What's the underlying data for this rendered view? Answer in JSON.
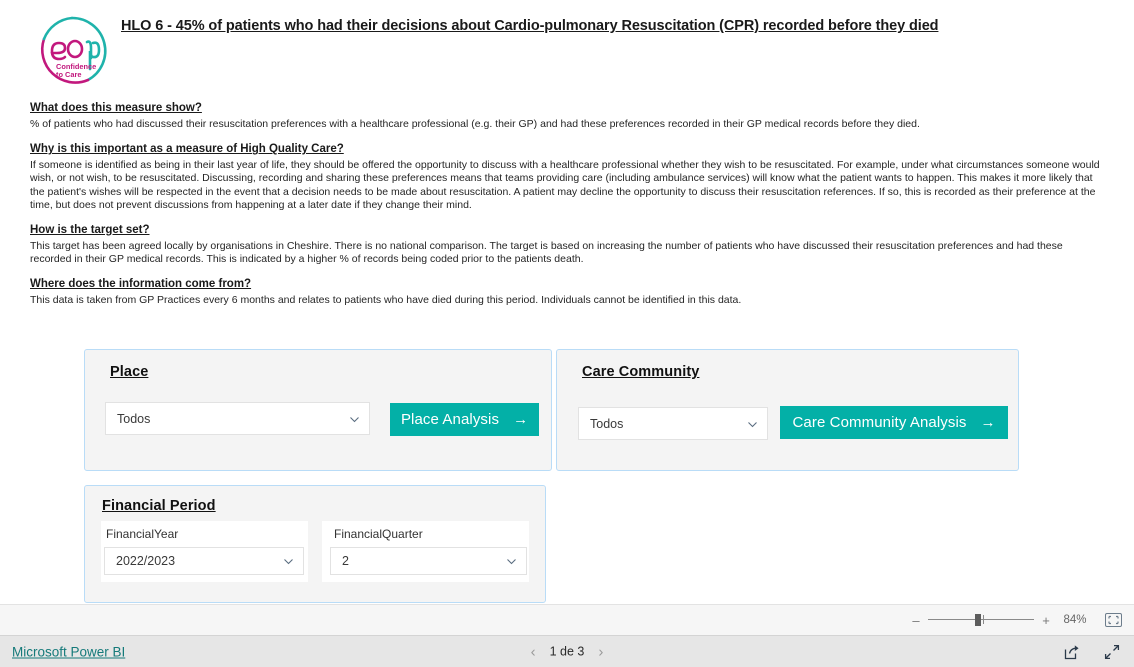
{
  "header": {
    "logo_alt": "eolp-confidence-to-care-logo",
    "logo_text_top": "eolp",
    "logo_text_line1": "Confidence",
    "logo_text_line2": "to Care",
    "title": "HLO 6 - 45% of patients who had their decisions about Cardio-pulmonary Resuscitation (CPR) recorded before they died"
  },
  "sections": [
    {
      "heading": "What does this measure show?",
      "body": "% of patients who had discussed their resuscitation preferences with a healthcare professional (e.g. their GP) and had these preferences recorded in their GP medical records before they died."
    },
    {
      "heading": "Why is this important as a measure of High Quality Care?",
      "body": "If someone is identified as being in their last year of life, they should be offered the opportunity to discuss with a healthcare professional whether they wish to be resuscitated. For example, under what circumstances someone would wish, or not wish, to be resuscitated. Discussing, recording and sharing these preferences means that teams providing care (including ambulance services) will know what the patient wants to happen. This makes it more likely that the patient's wishes will be respected in the event that a decision needs to be made about resuscitation. A patient may decline the opportunity to discuss their resuscitation references. If so, this is recorded as their preference at the time, but does not prevent discussions from happening at a later date if they change their mind."
    },
    {
      "heading": "How is the target set?",
      "body": "This target has been agreed locally by organisations in Cheshire. There is no national comparison. The target is based on increasing the number of patients who have discussed their resuscitation preferences and had these recorded in their GP medical records. This is indicated by a higher % of records being coded prior to the patients death."
    },
    {
      "heading": "Where does the information come from?",
      "body": "This data is taken from GP Practices every 6 months and relates to patients who have died during this period. Individuals cannot be identified in this data."
    }
  ],
  "cards": {
    "place": {
      "title": "Place",
      "slicer_value": "Todos",
      "button_label": "Place Analysis",
      "button_arrow": "→"
    },
    "care_community": {
      "title": "Care Community",
      "slicer_value": "Todos",
      "button_label": "Care Community Analysis",
      "button_arrow": "→"
    },
    "financial_period": {
      "title": "Financial Period",
      "year_label": "FinancialYear",
      "year_value": "2022/2023",
      "quarter_label": "FinancialQuarter",
      "quarter_value": "2"
    }
  },
  "zoombar": {
    "minus": "‒",
    "plus": "+",
    "percent": "84%",
    "fit_icon": "fit-to-page-icon"
  },
  "bottombar": {
    "brand": "Microsoft Power BI",
    "prev_icon": "‹",
    "page_label": "1 de 3",
    "next_icon": "›",
    "share_icon": "share-icon",
    "fullscreen_icon": "fullscreen-icon"
  },
  "colors": {
    "teal": "#03b0a7",
    "card_border": "#b9dcf7",
    "card_bg": "#f4f4f4",
    "link_teal": "#157a7a",
    "logo_magenta": "#c2187d",
    "logo_teal": "#1fb3ab"
  }
}
